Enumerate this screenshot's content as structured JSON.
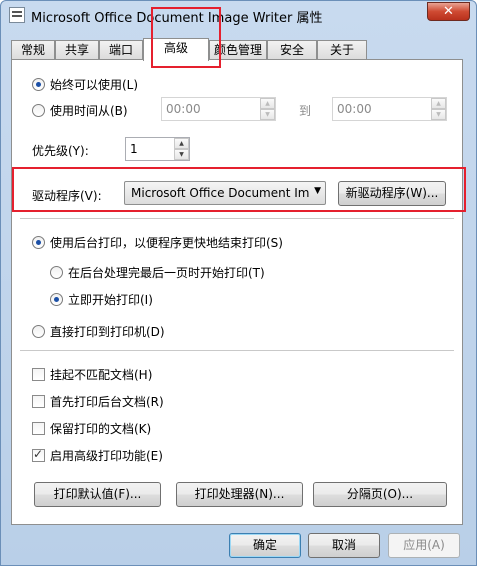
{
  "window": {
    "title": "Microsoft Office Document Image Writer 属性",
    "close_label": "✕"
  },
  "tabs": [
    {
      "label": "常规"
    },
    {
      "label": "共享"
    },
    {
      "label": "端口"
    },
    {
      "label": "高级"
    },
    {
      "label": "颜色管理"
    },
    {
      "label": "安全"
    },
    {
      "label": "关于"
    }
  ],
  "active_tab": "高级",
  "availability": {
    "always_label": "始终可以使用(L)",
    "from_label": "使用时间从(B)",
    "from_time": "00:00",
    "to_label": "到",
    "to_time": "00:00"
  },
  "priority": {
    "label": "优先级(Y):",
    "value": "1"
  },
  "driver": {
    "label": "驱动程序(V):",
    "value": "Microsoft Office Document Im",
    "new_driver_button": "新驱动程序(W)..."
  },
  "spool": {
    "spool_label": "使用后台打印，以便程序更快地结束打印(S)",
    "after_last_page_label": "在后台处理完最后一页时开始打印(T)",
    "immediately_label": "立即开始打印(I)",
    "direct_label": "直接打印到打印机(D)"
  },
  "options": [
    {
      "label": "挂起不匹配文档(H)",
      "checked": false
    },
    {
      "label": "首先打印后台文档(R)",
      "checked": false
    },
    {
      "label": "保留打印的文档(K)",
      "checked": false
    },
    {
      "label": "启用高级打印功能(E)",
      "checked": true
    }
  ],
  "bottom_buttons": {
    "defaults": "打印默认值(F)...",
    "processor": "打印处理器(N)...",
    "separator": "分隔页(O)..."
  },
  "footer": {
    "ok": "确定",
    "cancel": "取消",
    "apply": "应用(A)"
  },
  "colors": {
    "highlight": "#e5202e",
    "selected_radio": "#1b4fa6",
    "window_frame": "#b9cfe8"
  }
}
